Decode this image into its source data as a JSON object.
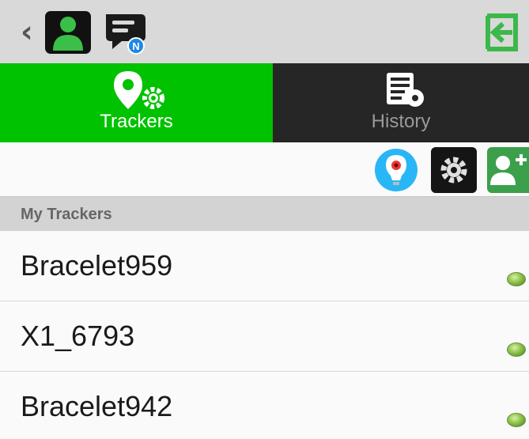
{
  "topbar": {
    "back_icon": "chevron-left-icon",
    "avatar_icon": "user-avatar-icon",
    "messages_icon": "chat-bubble-icon",
    "messages_badge": "N",
    "exit_icon": "exit-door-icon",
    "accent_color": "#3cb84a"
  },
  "tabs": [
    {
      "label": "Trackers",
      "icon": "map-pin-gear-icon",
      "active": true,
      "bg": "#00c200"
    },
    {
      "label": "History",
      "icon": "document-gear-icon",
      "active": false,
      "bg": "#262626"
    }
  ],
  "actions": [
    {
      "icon": "location-bulb-icon"
    },
    {
      "icon": "gear-icon"
    },
    {
      "icon": "add-user-icon"
    }
  ],
  "section": {
    "title": "My Trackers"
  },
  "trackers": [
    {
      "name": "Bracelet959",
      "status_color": "#8bc34a"
    },
    {
      "name": "X1_6793",
      "status_color": "#8bc34a"
    },
    {
      "name": "Bracelet942",
      "status_color": "#8bc34a"
    }
  ]
}
